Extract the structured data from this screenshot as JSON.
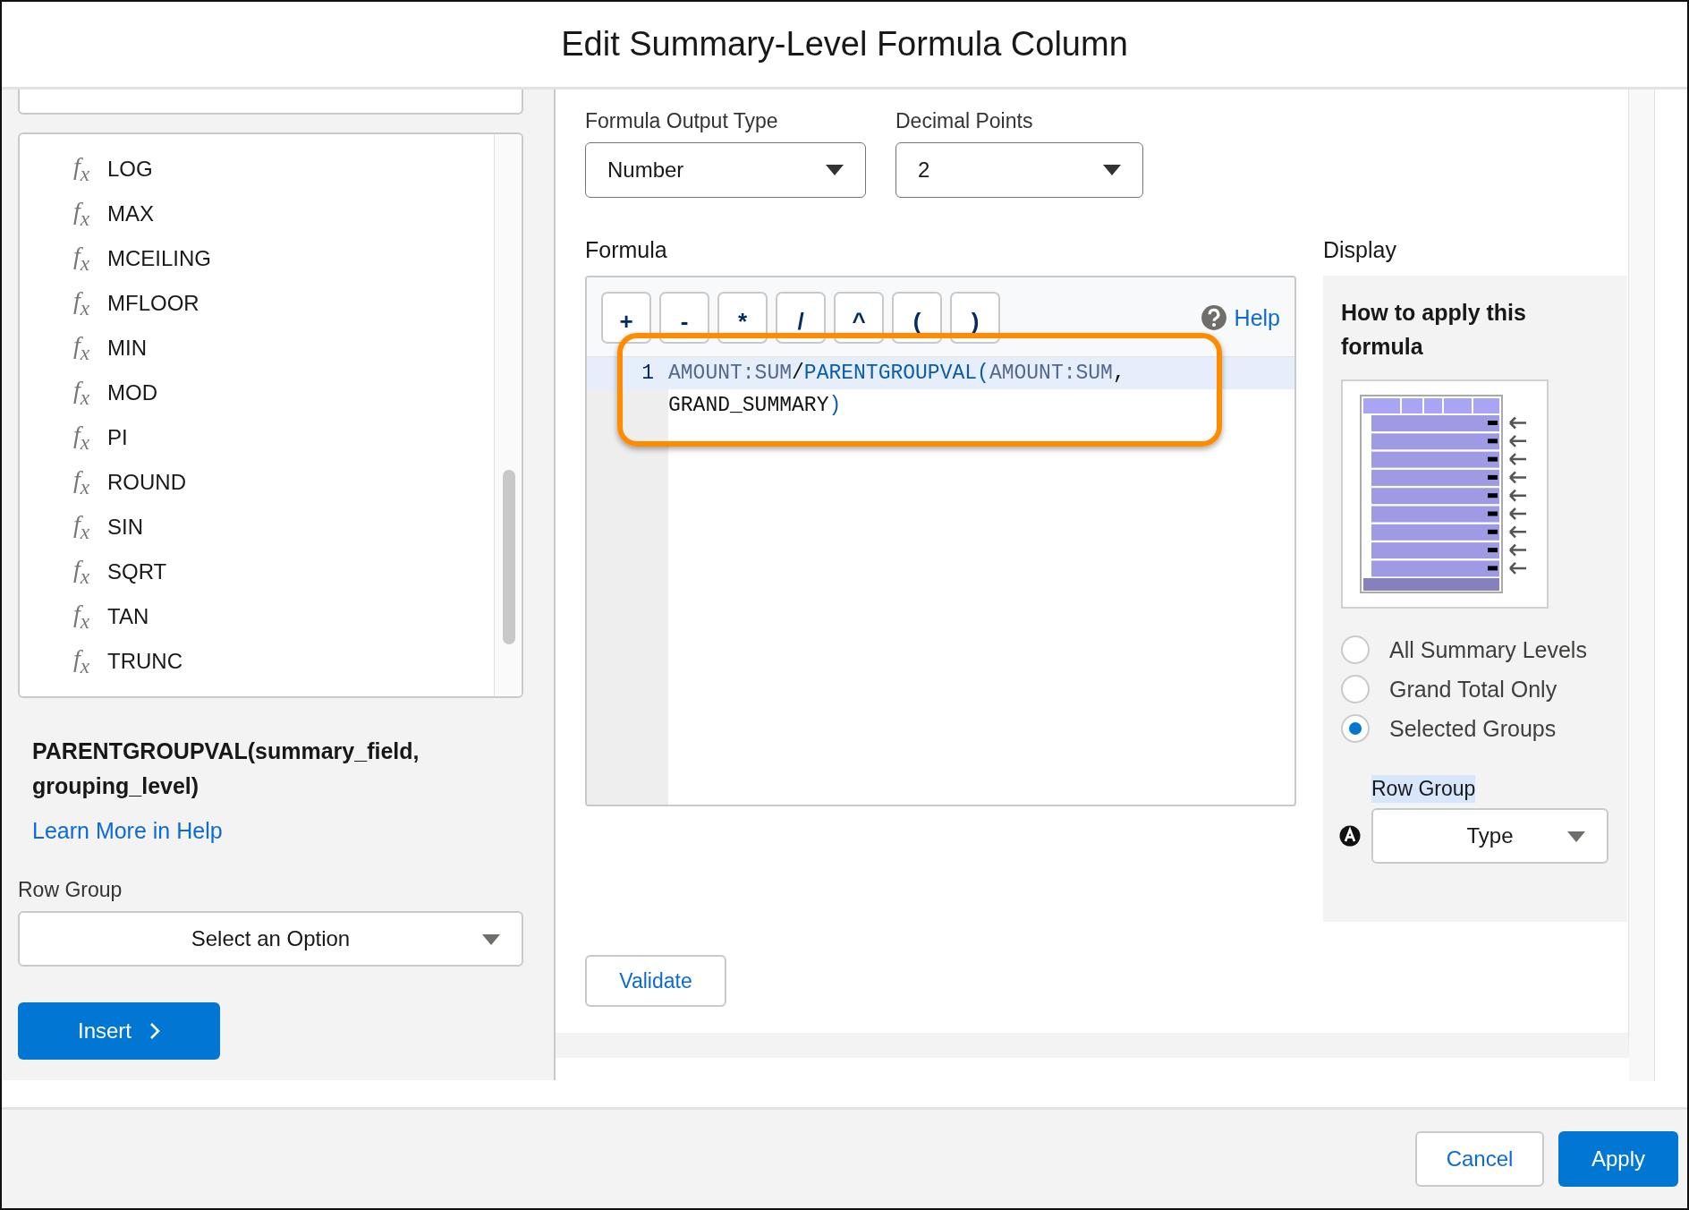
{
  "dialog": {
    "title": "Edit Summary-Level Formula Column"
  },
  "function_list": {
    "items": [
      {
        "icon": "f$_{x}$",
        "name": "LOG"
      },
      {
        "icon": "f$_{x}$",
        "name": "MAX"
      },
      {
        "icon": "f$_{x}$",
        "name": "MCEILING"
      },
      {
        "icon": "f$_{x}$",
        "name": "MFLOOR"
      },
      {
        "icon": "f$_{x}$",
        "name": "MIN"
      },
      {
        "icon": "f$_{x}$",
        "name": "MOD"
      },
      {
        "icon": "f$_{x}$",
        "name": "PI"
      },
      {
        "icon": "f$_{x}$",
        "name": "ROUND"
      },
      {
        "icon": "f$_{x}$",
        "name": "SIN"
      },
      {
        "icon": "f$_{x}$",
        "name": "SQRT"
      },
      {
        "icon": "f$_{x}$",
        "name": "TAN"
      },
      {
        "icon": "f$_{x}$",
        "name": "TRUNC"
      }
    ]
  },
  "function_detail": {
    "signature": "PARENTGROUPVAL(summary_field, grouping_level)",
    "help_link": "Learn More in Help"
  },
  "row_group": {
    "label": "Row Group",
    "value": "Select an Option"
  },
  "insert_button": "Insert",
  "output_type": {
    "label": "Formula Output Type",
    "value": "Number"
  },
  "decimal_points": {
    "label": "Decimal Points",
    "value": "2"
  },
  "formula": {
    "label": "Formula",
    "operators": [
      "+",
      "-",
      "*",
      "/",
      "^",
      "(",
      ")"
    ],
    "help": "Help",
    "lines": [
      {
        "number": "1",
        "tokens": [
          {
            "text": "AMOUNT:SUM",
            "kind": "field"
          },
          {
            "text": "/",
            "kind": "plain"
          },
          {
            "text": "PARENTGROUPVAL",
            "kind": "function"
          },
          {
            "text": "(",
            "kind": "function"
          },
          {
            "text": "AMOUNT:SUM",
            "kind": "field"
          },
          {
            "text": ",",
            "kind": "plain"
          },
          {
            "text": "GRAND_SUMMARY",
            "kind": "plain"
          },
          {
            "text": ")",
            "kind": "function"
          }
        ]
      }
    ]
  },
  "validate_button": "Validate",
  "display": {
    "label": "Display",
    "heading": "How to apply this formula",
    "options": [
      {
        "label": "All Summary Levels",
        "selected": false
      },
      {
        "label": "Grand Total Only",
        "selected": false
      },
      {
        "label": "Selected Groups",
        "selected": true
      }
    ],
    "row_group": {
      "label": "Row Group",
      "value": "Type"
    }
  },
  "footer": {
    "buttons": [
      {
        "label": "Cancel",
        "kind": "neutral"
      },
      {
        "label": "Apply",
        "kind": "brand"
      }
    ]
  }
}
